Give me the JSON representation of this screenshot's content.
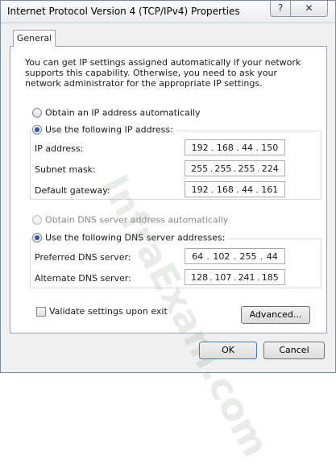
{
  "window": {
    "title": "Internet Protocol Version 4 (TCP/IPv4) Properties",
    "help_glyph": "?",
    "close_glyph": "✕"
  },
  "tabs": [
    {
      "label": "General",
      "selected": true
    }
  ],
  "description": "You can get IP settings assigned automatically if your network supports this capability. Otherwise, you need to ask your network administrator for the appropriate IP settings.",
  "ip": {
    "auto_label": "Obtain an IP address automatically",
    "manual_label": "Use the following IP address:",
    "selected": "manual",
    "fields": [
      {
        "label": "IP address:",
        "octets": [
          "192",
          "168",
          "44",
          "150"
        ]
      },
      {
        "label": "Subnet mask:",
        "octets": [
          "255",
          "255",
          "255",
          "224"
        ]
      },
      {
        "label": "Default gateway:",
        "octets": [
          "192",
          "168",
          "44",
          "161"
        ]
      }
    ]
  },
  "dns": {
    "auto_label": "Obtain DNS server address automatically",
    "manual_label": "Use the following DNS server addresses:",
    "selected": "manual",
    "fields": [
      {
        "label": "Preferred DNS server:",
        "octets": [
          "64",
          "102",
          "255",
          "44"
        ]
      },
      {
        "label": "Alternate DNS server:",
        "octets": [
          "128",
          "107",
          "241",
          "185"
        ]
      }
    ]
  },
  "validate": {
    "label": "Validate settings upon exit",
    "checked": false
  },
  "buttons": {
    "advanced": "Advanced...",
    "ok": "OK",
    "cancel": "Cancel"
  },
  "watermark": "InfraExam.com",
  "colors": {
    "selected_radio": "#2b5cae",
    "disabled_text": "#8a8a8a"
  }
}
